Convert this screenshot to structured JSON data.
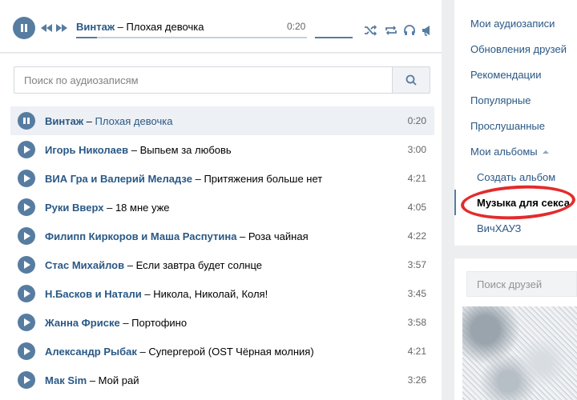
{
  "player": {
    "artist": "Винтаж",
    "dash": "–",
    "song": "Плохая девочка",
    "time": "0:20",
    "progress": 0.09,
    "volume": 1.0
  },
  "search": {
    "placeholder": "Поиск по аудиозаписям"
  },
  "tracks": [
    {
      "artist": "Винтаж",
      "dash": "–",
      "song": "Плохая девочка",
      "duration": "0:20",
      "state": "playing"
    },
    {
      "artist": "Игорь Николаев",
      "dash": "–",
      "song": "Выпьем за любовь",
      "duration": "3:00"
    },
    {
      "artist": "ВИА Гра и Валерий Меладзе",
      "dash": "–",
      "song": "Притяжения больше нет",
      "duration": "4:21"
    },
    {
      "artist": "Руки Вверх",
      "dash": "–",
      "song": "18 мне уже",
      "duration": "4:05"
    },
    {
      "artist": "Филипп Киркоров и Маша Распутина",
      "dash": "–",
      "song": "Роза чайная",
      "duration": "4:22"
    },
    {
      "artist": "Стас Михайлов",
      "dash": "–",
      "song": "Если завтра будет солнце",
      "duration": "3:57"
    },
    {
      "artist": "Н.Басков и Натали",
      "dash": "–",
      "song": "Никола, Николай, Коля!",
      "duration": "3:45"
    },
    {
      "artist": "Жанна Фриске",
      "dash": "–",
      "song": "Портофино",
      "duration": "3:58"
    },
    {
      "artist": "Александр Рыбак",
      "dash": "–",
      "song": "Супергерой (OST Чёрная молния)",
      "duration": "4:21"
    },
    {
      "artist": "Мак Sim",
      "dash": "–",
      "song": "Мой рай",
      "duration": "3:26"
    }
  ],
  "sidebar": {
    "items": [
      "Мои аудиозаписи",
      "Обновления друзей",
      "Рекомендации",
      "Популярные",
      "Прослушанные",
      "Мои альбомы"
    ],
    "albums": [
      "Создать альбом",
      "Музыка для секса",
      "ВичХАУЗ"
    ],
    "selected_album": "Музыка для секса"
  },
  "friends": {
    "placeholder": "Поиск друзей"
  },
  "colors": {
    "accent": "#577ca1",
    "link": "#2a5885",
    "highlight_circle": "#e32b2b"
  },
  "icons": [
    "pause-icon",
    "prev-icon",
    "next-icon",
    "shuffle-icon",
    "repeat-icon",
    "headphones-icon",
    "broadcast-icon",
    "search-icon",
    "play-icon"
  ]
}
